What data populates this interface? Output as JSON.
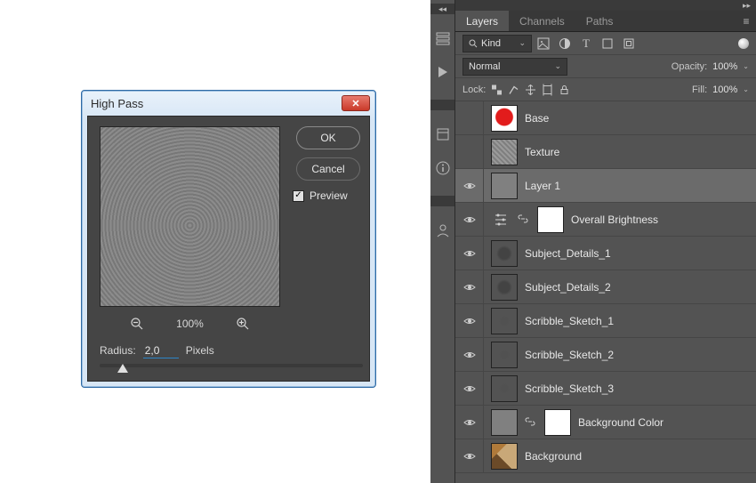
{
  "dialog": {
    "title": "High Pass",
    "ok": "OK",
    "cancel": "Cancel",
    "preview_label": "Preview",
    "preview_checked": true,
    "zoom": "100%",
    "radius_label": "Radius:",
    "radius_value": "2,0",
    "radius_unit": "Pixels"
  },
  "panel": {
    "tabs": [
      {
        "label": "Layers",
        "active": true
      },
      {
        "label": "Channels",
        "active": false
      },
      {
        "label": "Paths",
        "active": false
      }
    ],
    "filter": {
      "kind_label": "Kind"
    },
    "blend": {
      "mode": "Normal",
      "opacity_label": "Opacity:",
      "opacity": "100%"
    },
    "lock": {
      "label": "Lock:",
      "fill_label": "Fill:",
      "fill": "100%"
    },
    "layers": [
      {
        "name": "Base",
        "visible": false,
        "thumb": "red-blob"
      },
      {
        "name": "Texture",
        "visible": false,
        "thumb": "grey-noise"
      },
      {
        "name": "Layer 1",
        "visible": true,
        "thumb": "solid-grey",
        "selected": true
      },
      {
        "name": "Overall Brightness",
        "visible": true,
        "adjustment": true
      },
      {
        "name": "Subject_Details_1",
        "visible": true,
        "thumb": "sketch-thumb checker"
      },
      {
        "name": "Subject_Details_2",
        "visible": true,
        "thumb": "sketch-thumb checker"
      },
      {
        "name": "Scribble_Sketch_1",
        "visible": true,
        "thumb": "scribble-thumb checker"
      },
      {
        "name": "Scribble_Sketch_2",
        "visible": true,
        "thumb": "scribble-thumb checker"
      },
      {
        "name": "Scribble_Sketch_3",
        "visible": true,
        "thumb": "scribble-thumb checker"
      },
      {
        "name": "Background Color",
        "visible": true,
        "thumb": "solid-grey",
        "linked_mask": true
      },
      {
        "name": "Background",
        "visible": true,
        "thumb": "img-thumb"
      }
    ]
  }
}
